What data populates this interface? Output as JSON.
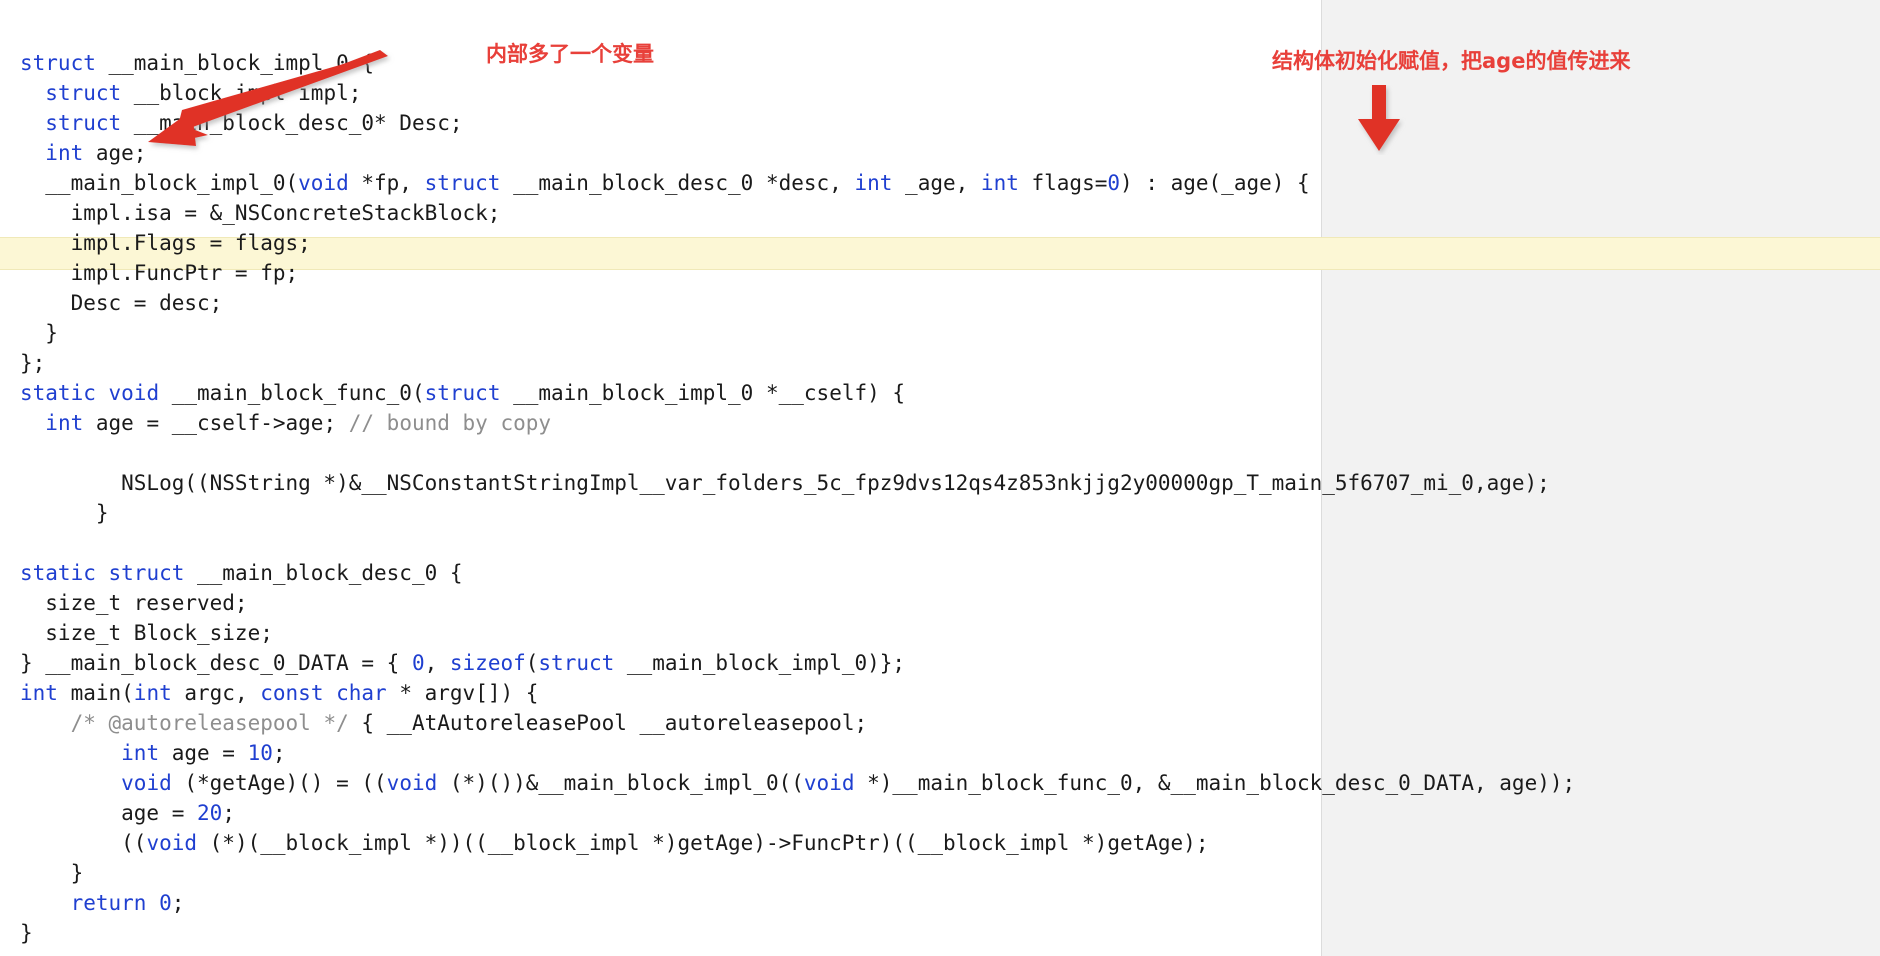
{
  "editor": {
    "theme_background": "#ffffff",
    "right_pane_background": "#f2f2f2",
    "highlight_color": "#fcf7d5",
    "keyword_color": "#1f3fd0",
    "comment_color": "#8e8e8e",
    "annotation_color": "#e8403a",
    "highlighted_line_index": 6
  },
  "annotations": {
    "left": {
      "text": "内部多了一个变量",
      "icon": "red-arrow-down-left-icon"
    },
    "right": {
      "text": "结构体初始化赋值，把age的值传进来",
      "icon": "red-arrow-down-icon"
    }
  },
  "code": {
    "language": "objective-c",
    "lines": [
      [
        {
          "t": "struct",
          "c": "kw"
        },
        {
          "t": " __main_block_impl_0 {",
          "c": "pln"
        }
      ],
      [
        {
          "t": "  ",
          "c": "pln"
        },
        {
          "t": "struct",
          "c": "kw"
        },
        {
          "t": " __block_impl impl;",
          "c": "pln"
        }
      ],
      [
        {
          "t": "  ",
          "c": "pln"
        },
        {
          "t": "struct",
          "c": "kw"
        },
        {
          "t": " __main_block_desc_0* Desc;",
          "c": "pln"
        }
      ],
      [
        {
          "t": "  ",
          "c": "pln"
        },
        {
          "t": "int",
          "c": "kw"
        },
        {
          "t": " age;",
          "c": "pln"
        }
      ],
      [
        {
          "t": "  __main_block_impl_0(",
          "c": "pln"
        },
        {
          "t": "void",
          "c": "kw"
        },
        {
          "t": " *fp, ",
          "c": "pln"
        },
        {
          "t": "struct",
          "c": "kw"
        },
        {
          "t": " __main_block_desc_0 *desc, ",
          "c": "pln"
        },
        {
          "t": "int",
          "c": "kw"
        },
        {
          "t": " _age, ",
          "c": "pln"
        },
        {
          "t": "int",
          "c": "kw"
        },
        {
          "t": " flags=",
          "c": "pln"
        },
        {
          "t": "0",
          "c": "num"
        },
        {
          "t": ") : age(_age) {",
          "c": "pln"
        }
      ],
      [
        {
          "t": "    impl.isa = &_NSConcreteStackBlock;",
          "c": "pln"
        }
      ],
      [
        {
          "t": "    impl.Flags = flags;",
          "c": "pln"
        }
      ],
      [
        {
          "t": "    impl.FuncPtr = fp;",
          "c": "pln"
        }
      ],
      [
        {
          "t": "    Desc = desc;",
          "c": "pln"
        }
      ],
      [
        {
          "t": "  }",
          "c": "pln"
        }
      ],
      [
        {
          "t": "};",
          "c": "pln"
        }
      ],
      [
        {
          "t": "static",
          "c": "kw"
        },
        {
          "t": " ",
          "c": "pln"
        },
        {
          "t": "void",
          "c": "kw"
        },
        {
          "t": " __main_block_func_0(",
          "c": "pln"
        },
        {
          "t": "struct",
          "c": "kw"
        },
        {
          "t": " __main_block_impl_0 *__cself) {",
          "c": "pln"
        }
      ],
      [
        {
          "t": "  ",
          "c": "pln"
        },
        {
          "t": "int",
          "c": "kw"
        },
        {
          "t": " age = __cself->age; ",
          "c": "pln"
        },
        {
          "t": "// bound by copy",
          "c": "cmt"
        }
      ],
      [
        {
          "t": "",
          "c": "pln"
        }
      ],
      [
        {
          "t": "        NSLog((NSString *)&__NSConstantStringImpl__var_folders_5c_fpz9dvs12qs4z853nkjjg2y00000gp_T_main_5f6707_mi_0,age);",
          "c": "pln"
        }
      ],
      [
        {
          "t": "      }",
          "c": "pln"
        }
      ],
      [
        {
          "t": "",
          "c": "pln"
        }
      ],
      [
        {
          "t": "static",
          "c": "kw"
        },
        {
          "t": " ",
          "c": "pln"
        },
        {
          "t": "struct",
          "c": "kw"
        },
        {
          "t": " __main_block_desc_0 {",
          "c": "pln"
        }
      ],
      [
        {
          "t": "  size_t reserved;",
          "c": "pln"
        }
      ],
      [
        {
          "t": "  size_t Block_size;",
          "c": "pln"
        }
      ],
      [
        {
          "t": "} __main_block_desc_0_DATA = { ",
          "c": "pln"
        },
        {
          "t": "0",
          "c": "num"
        },
        {
          "t": ", ",
          "c": "pln"
        },
        {
          "t": "sizeof",
          "c": "kw"
        },
        {
          "t": "(",
          "c": "pln"
        },
        {
          "t": "struct",
          "c": "kw"
        },
        {
          "t": " __main_block_impl_0)};",
          "c": "pln"
        }
      ],
      [
        {
          "t": "int",
          "c": "kw"
        },
        {
          "t": " main(",
          "c": "pln"
        },
        {
          "t": "int",
          "c": "kw"
        },
        {
          "t": " argc, ",
          "c": "pln"
        },
        {
          "t": "const",
          "c": "kw"
        },
        {
          "t": " ",
          "c": "pln"
        },
        {
          "t": "char",
          "c": "kw"
        },
        {
          "t": " * argv[]) {",
          "c": "pln"
        }
      ],
      [
        {
          "t": "    ",
          "c": "pln"
        },
        {
          "t": "/* @autoreleasepool */",
          "c": "cmt"
        },
        {
          "t": " { __AtAutoreleasePool __autoreleasepool;",
          "c": "pln"
        }
      ],
      [
        {
          "t": "        ",
          "c": "pln"
        },
        {
          "t": "int",
          "c": "kw"
        },
        {
          "t": " age = ",
          "c": "pln"
        },
        {
          "t": "10",
          "c": "num"
        },
        {
          "t": ";",
          "c": "pln"
        }
      ],
      [
        {
          "t": "        ",
          "c": "pln"
        },
        {
          "t": "void",
          "c": "kw"
        },
        {
          "t": " (*getAge)() = ((",
          "c": "pln"
        },
        {
          "t": "void",
          "c": "kw"
        },
        {
          "t": " (*)())&__main_block_impl_0((",
          "c": "pln"
        },
        {
          "t": "void",
          "c": "kw"
        },
        {
          "t": " *)__main_block_func_0, &__main_block_desc_0_DATA, age));",
          "c": "pln"
        }
      ],
      [
        {
          "t": "        age = ",
          "c": "pln"
        },
        {
          "t": "20",
          "c": "num"
        },
        {
          "t": ";",
          "c": "pln"
        }
      ],
      [
        {
          "t": "        ((",
          "c": "pln"
        },
        {
          "t": "void",
          "c": "kw"
        },
        {
          "t": " (*)(__block_impl *))((__block_impl *)getAge)->FuncPtr)((__block_impl *)getAge);",
          "c": "pln"
        }
      ],
      [
        {
          "t": "    }",
          "c": "pln"
        }
      ],
      [
        {
          "t": "    ",
          "c": "pln"
        },
        {
          "t": "return",
          "c": "kw"
        },
        {
          "t": " ",
          "c": "pln"
        },
        {
          "t": "0",
          "c": "num"
        },
        {
          "t": ";",
          "c": "pln"
        }
      ],
      [
        {
          "t": "}",
          "c": "pln"
        }
      ]
    ]
  }
}
